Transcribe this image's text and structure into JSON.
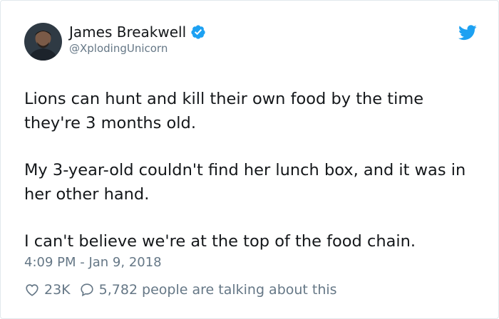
{
  "author": {
    "name": "James Breakwell",
    "handle": "@XplodingUnicorn",
    "verified": true
  },
  "tweet": {
    "paragraphs": [
      "Lions can hunt and kill their own food by the time they're 3 months old.",
      "My 3-year-old couldn't find her lunch box, and it was in her other hand.",
      "I can't believe we're at the top of the food chain."
    ],
    "timestamp": "4:09 PM - Jan 9, 2018"
  },
  "actions": {
    "likes": "23K",
    "replies": "5,782",
    "replies_suffix": "people are talking about this"
  },
  "icons": {
    "avatar": "avatar-photo",
    "verified": "verified-badge-icon",
    "brand": "twitter-bird-icon",
    "like": "heart-icon",
    "reply": "speech-bubble-icon"
  },
  "colors": {
    "brand": "#1da1f2",
    "secondary_text": "#657786",
    "primary_text": "#14171a"
  }
}
